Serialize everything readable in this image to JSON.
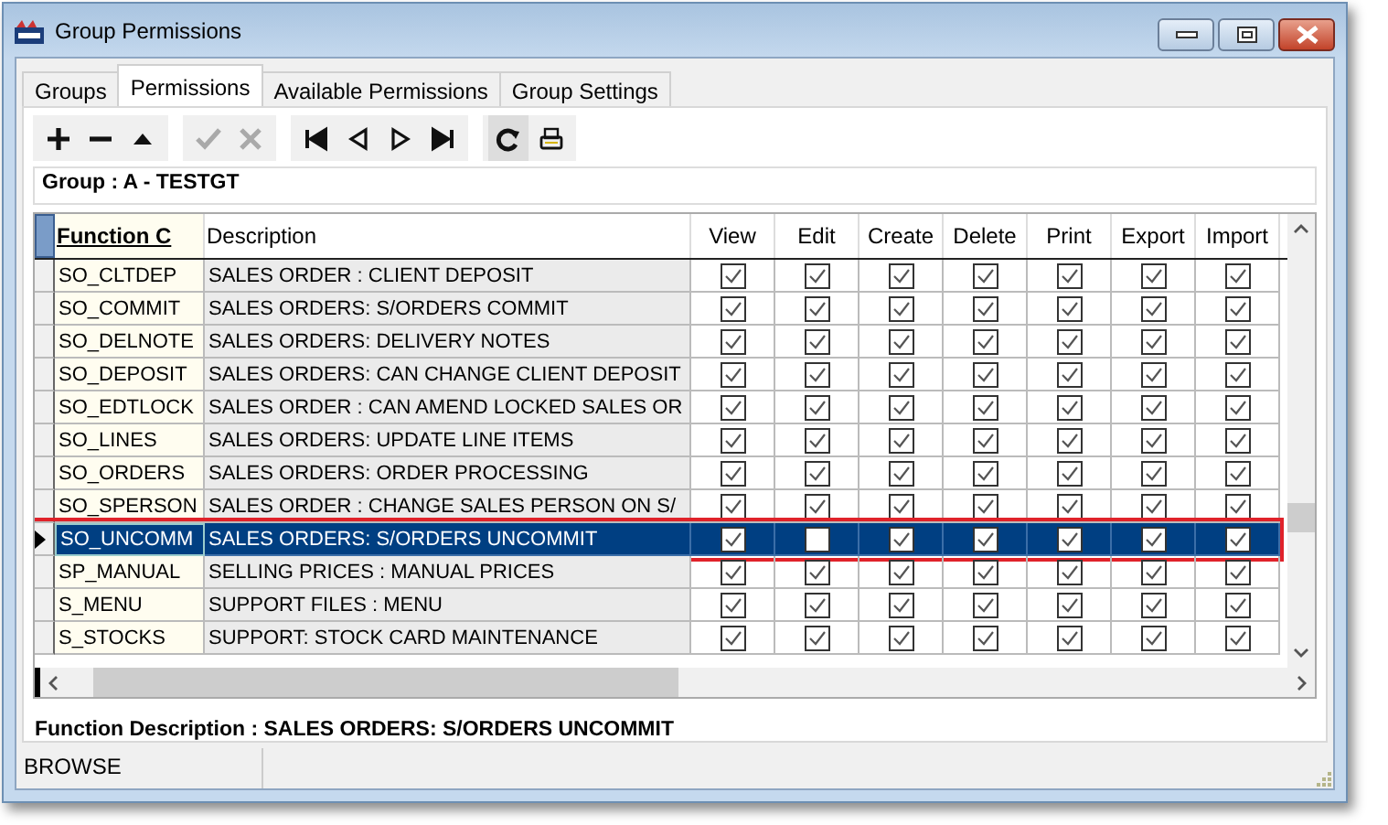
{
  "window": {
    "title": "Group Permissions"
  },
  "tabs": [
    {
      "label": "Groups",
      "selected": false
    },
    {
      "label": "Permissions",
      "selected": true
    },
    {
      "label": "Available Permissions",
      "selected": false
    },
    {
      "label": "Group Settings",
      "selected": false
    }
  ],
  "toolbar": [
    {
      "kind": "add",
      "disabled": false
    },
    {
      "kind": "remove",
      "disabled": false
    },
    {
      "kind": "up",
      "disabled": false
    },
    {
      "kind": "confirm",
      "disabled": true
    },
    {
      "kind": "cancel",
      "disabled": true
    },
    {
      "kind": "first",
      "disabled": false
    },
    {
      "kind": "prev",
      "disabled": false
    },
    {
      "kind": "next",
      "disabled": false
    },
    {
      "kind": "last",
      "disabled": false
    },
    {
      "kind": "refresh",
      "disabled": false
    },
    {
      "kind": "print",
      "disabled": false
    }
  ],
  "group_label": "Group : A - TESTGT",
  "table": {
    "columns": [
      "Function C",
      "Description",
      "View",
      "Edit",
      "Create",
      "Delete",
      "Print",
      "Export",
      "Import"
    ],
    "rows": [
      {
        "code": "SO_CLTDEP",
        "description": "SALES ORDER : CLIENT DEPOSIT",
        "selected": false,
        "highlighted": false,
        "perms": [
          true,
          true,
          true,
          true,
          true,
          true,
          true
        ]
      },
      {
        "code": "SO_COMMIT",
        "description": "SALES ORDERS: S/ORDERS COMMIT",
        "selected": false,
        "highlighted": false,
        "perms": [
          true,
          true,
          true,
          true,
          true,
          true,
          true
        ]
      },
      {
        "code": "SO_DELNOTE",
        "description": "SALES ORDERS: DELIVERY NOTES",
        "selected": false,
        "highlighted": false,
        "perms": [
          true,
          true,
          true,
          true,
          true,
          true,
          true
        ]
      },
      {
        "code": "SO_DEPOSIT",
        "description": "SALES ORDERS: CAN CHANGE CLIENT DEPOSIT",
        "selected": false,
        "highlighted": false,
        "perms": [
          true,
          true,
          true,
          true,
          true,
          true,
          true
        ]
      },
      {
        "code": "SO_EDTLOCK",
        "description": "SALES ORDER : CAN AMEND LOCKED SALES OR",
        "selected": false,
        "highlighted": false,
        "perms": [
          true,
          true,
          true,
          true,
          true,
          true,
          true
        ]
      },
      {
        "code": "SO_LINES",
        "description": "SALES ORDERS: UPDATE LINE ITEMS",
        "selected": false,
        "highlighted": false,
        "perms": [
          true,
          true,
          true,
          true,
          true,
          true,
          true
        ]
      },
      {
        "code": "SO_ORDERS",
        "description": "SALES ORDERS: ORDER PROCESSING",
        "selected": false,
        "highlighted": false,
        "perms": [
          true,
          true,
          true,
          true,
          true,
          true,
          true
        ]
      },
      {
        "code": "SO_SPERSON",
        "description": "SALES ORDER : CHANGE SALES PERSON ON S/",
        "selected": false,
        "highlighted": false,
        "perms": [
          true,
          true,
          true,
          true,
          true,
          true,
          true
        ]
      },
      {
        "code": "SO_UNCOMM",
        "description": "SALES ORDERS: S/ORDERS UNCOMMIT",
        "selected": true,
        "highlighted": true,
        "perms": [
          true,
          false,
          true,
          true,
          true,
          true,
          true
        ]
      },
      {
        "code": "SP_MANUAL",
        "description": "SELLING PRICES : MANUAL PRICES",
        "selected": false,
        "highlighted": false,
        "perms": [
          true,
          true,
          true,
          true,
          true,
          true,
          true
        ]
      },
      {
        "code": "S_MENU",
        "description": "SUPPORT FILES : MENU",
        "selected": false,
        "highlighted": false,
        "perms": [
          true,
          true,
          true,
          true,
          true,
          true,
          true
        ]
      },
      {
        "code": "S_STOCKS",
        "description": "SUPPORT: STOCK CARD MAINTENANCE",
        "selected": false,
        "highlighted": false,
        "perms": [
          true,
          true,
          true,
          true,
          true,
          true,
          true
        ]
      }
    ]
  },
  "function_description": "Function Description : SALES ORDERS: S/ORDERS UNCOMMIT",
  "status_bar": {
    "mode": "BROWSE"
  }
}
